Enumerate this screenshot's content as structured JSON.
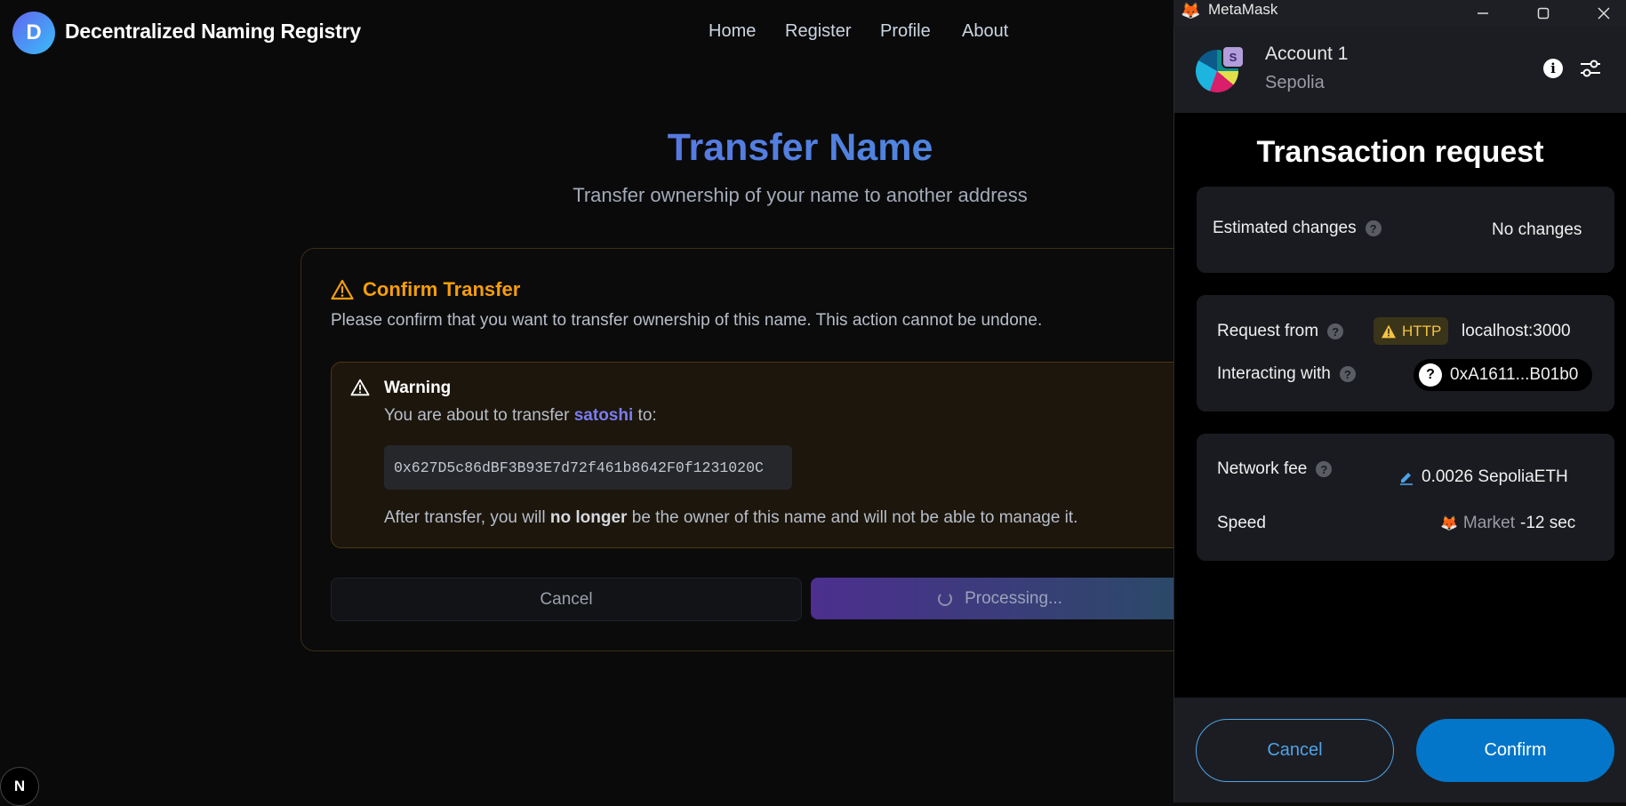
{
  "app": {
    "logo_letter": "D",
    "title": "Decentralized Naming Registry",
    "nav": [
      "Home",
      "Register",
      "Profile",
      "About"
    ]
  },
  "page": {
    "title": "Transfer Name",
    "subtitle": "Transfer ownership of your name to another address"
  },
  "confirm": {
    "title": "Confirm Transfer",
    "description": "Please confirm that you want to transfer ownership of this name. This action cannot be undone.",
    "warning_title": "Warning",
    "warning_prefix": "You are about to transfer ",
    "name": "satoshi",
    "warning_suffix": " to:",
    "address": "0x627D5c86dBF3B93E7d72f461b8642F0f1231020C",
    "after_prefix": "After transfer, you will ",
    "after_bold": "no longer",
    "after_suffix": " be the owner of this name and will not be able to manage it.",
    "cancel_label": "Cancel",
    "processing_label": "Processing..."
  },
  "next_badge": "N",
  "metamask": {
    "window_title": "MetaMask",
    "account_badge": "S",
    "account_name": "Account 1",
    "network": "Sepolia",
    "heading": "Transaction request",
    "estimated_changes_label": "Estimated changes",
    "estimated_changes_value": "No changes",
    "request_from_label": "Request from",
    "http_badge": "HTTP",
    "origin": "localhost:3000",
    "interacting_with_label": "Interacting with",
    "contract": "0xA1611...B01b0",
    "network_fee_label": "Network fee",
    "network_fee_value": "0.0026 SepoliaETH",
    "speed_label": "Speed",
    "speed_value": "Market",
    "speed_time": "-12 sec",
    "cancel_label": "Cancel",
    "confirm_label": "Confirm"
  },
  "colors": {
    "accent_gradient_start": "#6d5ce7",
    "accent_gradient_end": "#38a3d9",
    "warning": "#f59e0b",
    "mm_primary": "#0376c9"
  }
}
